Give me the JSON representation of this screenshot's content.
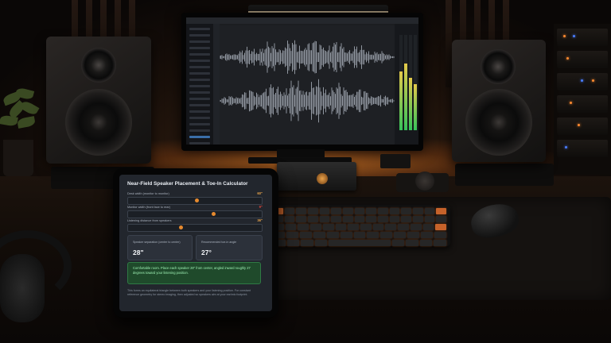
{
  "calculator": {
    "title": "Near-Field Speaker Placement & Toe-In Calculator",
    "sliders": [
      {
        "label": "Desk width (monitor to monitor)",
        "value": "60\"",
        "value_color": "#e6a24a",
        "fraction": 0.52
      },
      {
        "label": "Monitor width (front face to rear)",
        "value": "9\"",
        "value_color": "#e0463a",
        "fraction": 0.64
      },
      {
        "label": "Listening distance from speakers",
        "value": "36\"",
        "value_color": "#e6a24a",
        "fraction": 0.4
      }
    ],
    "results": [
      {
        "label": "Speaker separation (center to center)",
        "value": "28\""
      },
      {
        "label": "Recommended toe-in angle",
        "value": "27°"
      }
    ],
    "recommendation": "Comfortable room. Place each speaker 28\" from center, angled inward roughly 27 degrees toward your listening position.",
    "footnote": "This forms an equilateral triangle between both speakers and your listening position. For constant reference geometry for stereo imaging, then adjusted so speakers aim at your ear/mic footprint."
  },
  "daw": {
    "sidebar_rows": 22,
    "active_row": 17,
    "meter_levels": [
      0.62,
      0.7,
      0.55,
      0.48
    ]
  },
  "colors": {
    "accent": "#e68a2e",
    "success_bg": "#1f4a2b",
    "success_text": "#9ef0b4",
    "screen_bg": "#1b1d21",
    "ambient_glow": "#ff8c28"
  }
}
